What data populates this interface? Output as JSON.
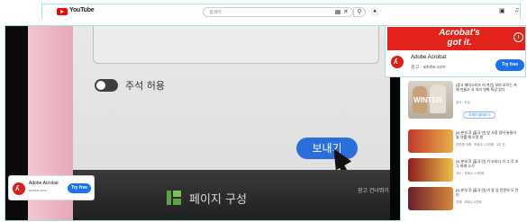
{
  "youtube": {
    "logo_text": "YouTube",
    "search_placeholder": "검색어",
    "clear_icon": "close-icon",
    "search_icon": "search-icon"
  },
  "player": {
    "toggle_label": "주석 허용",
    "send_button": "보내기",
    "page_config_label": "페이지 구성",
    "ad_label": "광고 건너뛰기",
    "mini_ad": {
      "title": "Adobe Acrobat",
      "subtitle": "adobe.com",
      "button": "Try free"
    }
  },
  "sidebar_ad": {
    "banner_line1": "Acrobat's",
    "banner_line2": "got it.",
    "title": "Adobe Acrobat",
    "subtitle": "광고 · adobe.com",
    "button": "Try free"
  },
  "recommendations": [
    {
      "title": "[광고 재미시리즈 리 겨진] 모아 모르는 자제 만들고 사 지리 영화 특강 있다",
      "meta": "광고 · 도남",
      "button": "자세히 알아보기"
    },
    {
      "title": "[4] 본부 후 [출국 안] 방 사정 있어 놓들이 될 자를 해 오맛 원",
      "meta": "전만큼 미래 · 조회수 2.1만회 · 3주 전"
    },
    {
      "title": "[4] 본부 후 [출국 안] 기 오타니 가 그 후 조 그 미래 소식",
      "meta": "국수 · 조회수 1.9만회"
    },
    {
      "title": "[4] 본부 후 [출국 안] 미 용 업 전문의 오 전 다",
      "meta": "연예 · 조회수 8천회"
    }
  ],
  "colors": {
    "accent_blue": "#2a6edb",
    "acrobat_red": "#e2231a",
    "youtube_red": "#ff0000"
  }
}
